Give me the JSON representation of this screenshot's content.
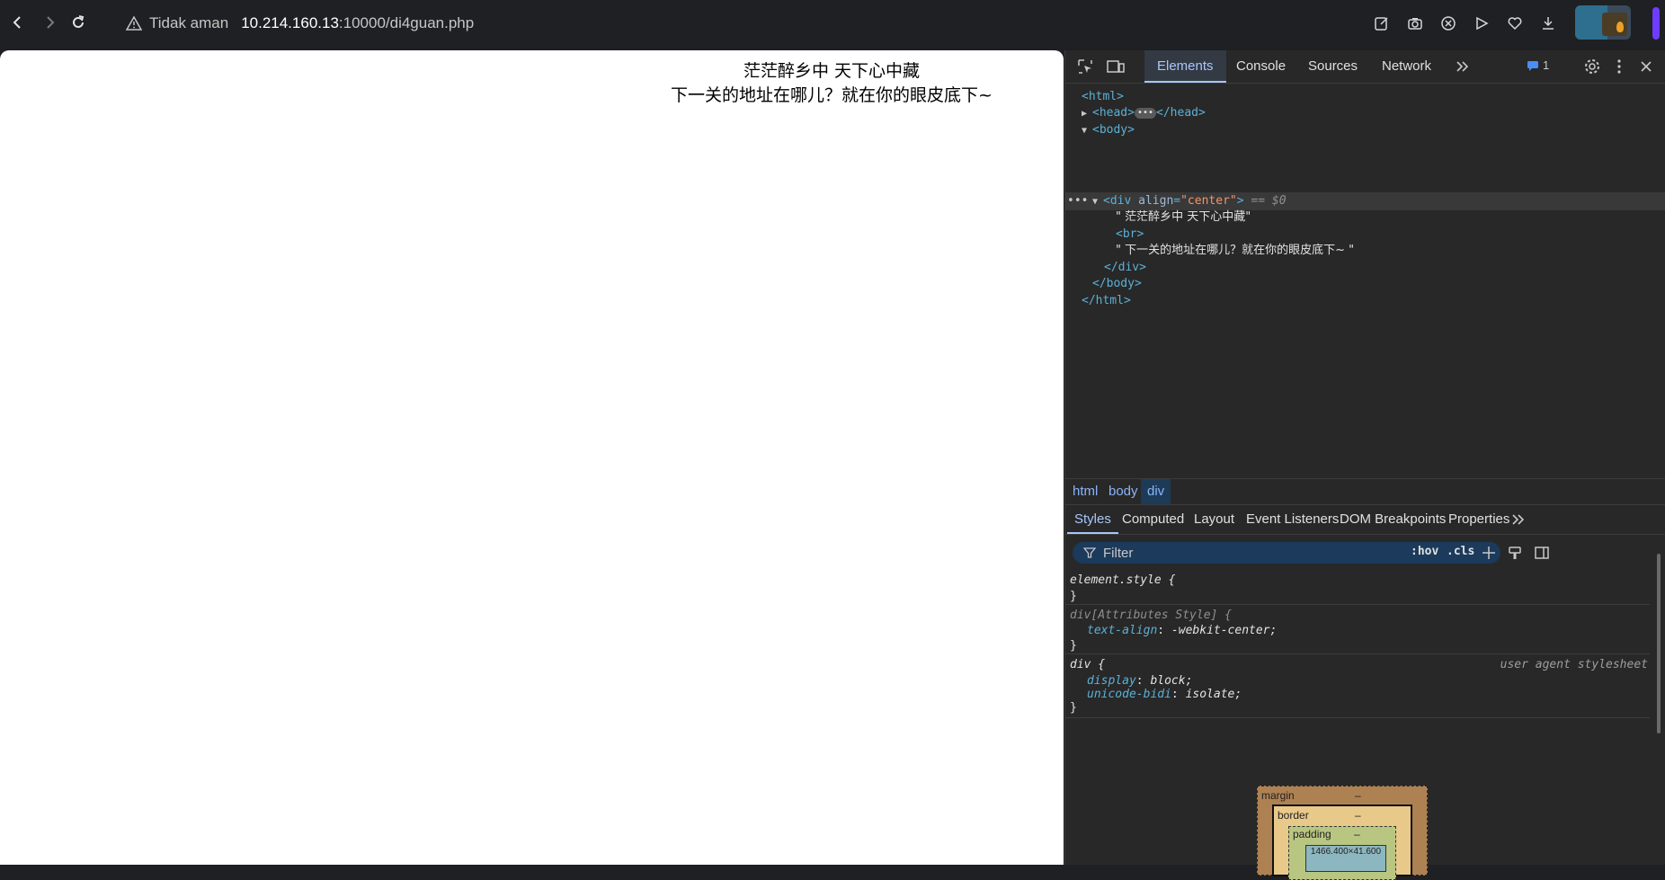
{
  "browser": {
    "security_label": "Tidak aman",
    "url_host": "10.214.160.13",
    "url_path": ":10000/di4guan.php"
  },
  "page": {
    "line1": "茫茫醉乡中 天下心中藏",
    "line2": "下一关的地址在哪儿？就在你的眼皮底下~"
  },
  "devtools": {
    "tabs": [
      "Elements",
      "Console",
      "Sources",
      "Network"
    ],
    "issues_count": "1",
    "tree": {
      "html_open": "<html>",
      "head_open": "<head>",
      "head_close": "</head>",
      "body_open": "<body>",
      "div_tag": "<div ",
      "div_attr": "align",
      "div_eq": "=",
      "div_val": "\"center\"",
      "div_end": ">",
      "div_marker": " == $0",
      "text1": "\" 茫茫醉乡中 天下心中藏\"",
      "br": "<br>",
      "text2": "\" 下一关的地址在哪儿？就在你的眼皮底下~ \"",
      "div_close": "</div>",
      "body_close": "</body>",
      "html_close": "</html>"
    },
    "breadcrumbs": [
      "html",
      "body",
      "div"
    ],
    "style_tabs": [
      "Styles",
      "Computed",
      "Layout",
      "Event Listeners",
      "DOM Breakpoints",
      "Properties"
    ],
    "filter_placeholder": "Filter",
    "hov": ":hov",
    "cls": ".cls",
    "rules": {
      "r1_selector": "element.style {",
      "r1_close": "}",
      "r2_selector": "div[Attributes Style] {",
      "r2_prop": "text-align",
      "r2_val": " -webkit-center;",
      "r2_close": "}",
      "r3_selector": "div {",
      "r3_origin": "user agent stylesheet",
      "r3_prop1": "display",
      "r3_val1": " block;",
      "r3_prop2": "unicode-bidi",
      "r3_val2": " isolate;",
      "r3_close": "}"
    },
    "box_model": {
      "margin_label": "margin",
      "margin_val": "–",
      "border_label": "border",
      "border_val": "–",
      "padding_label": "padding",
      "padding_val": "–",
      "content_size": "1466.400×41.600"
    }
  },
  "colors": {
    "accent": "#a8c7fa",
    "tag": "#5db0d7",
    "attr_value": "#f29766"
  }
}
